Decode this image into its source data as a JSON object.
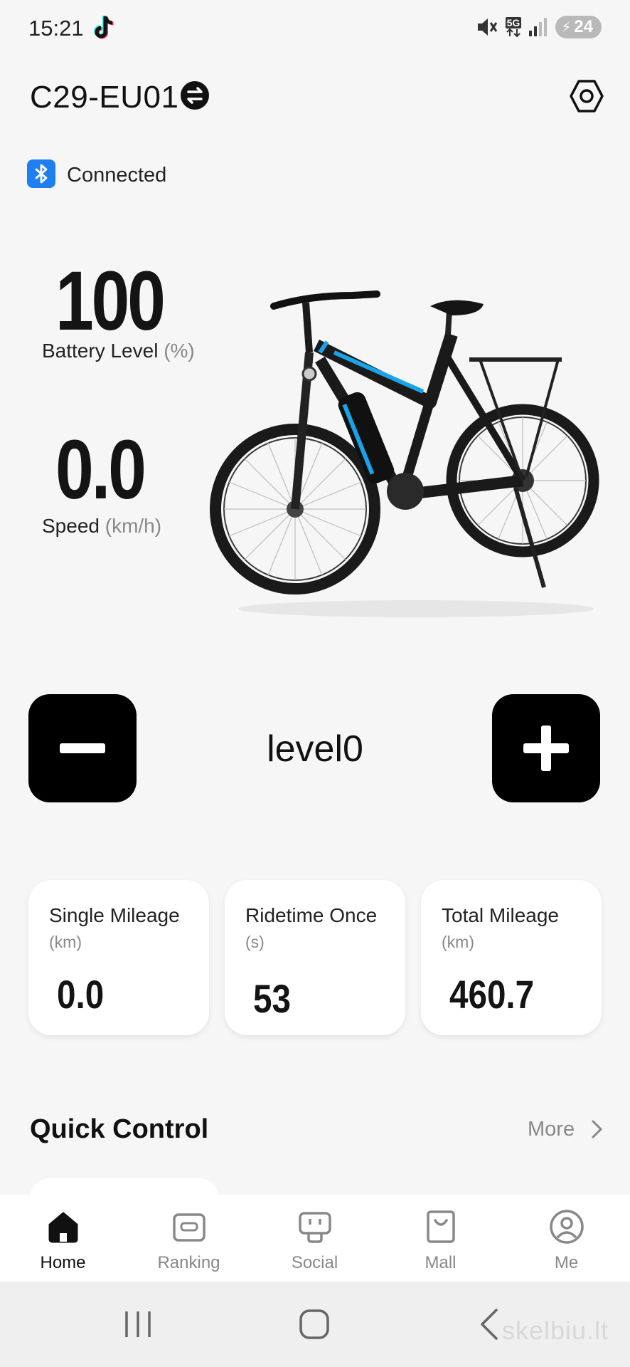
{
  "status_bar": {
    "time": "15:21",
    "network": "5G",
    "battery": "24"
  },
  "header": {
    "device_name": "C29-EU01",
    "connection_status": "Connected"
  },
  "metrics": {
    "battery_value": "100",
    "battery_label": "Battery Level",
    "battery_unit": "(%)",
    "speed_value": "0.0",
    "speed_label": "Speed",
    "speed_unit": "(km/h)"
  },
  "assist": {
    "level": "level0"
  },
  "stats": [
    {
      "title": "Single Mileage",
      "unit": "(km)",
      "value": "0.0"
    },
    {
      "title": "Ridetime Once",
      "unit": "(s)",
      "value": "53"
    },
    {
      "title": "Total Mileage",
      "unit": "(km)",
      "value": "460.7"
    }
  ],
  "quick_control": {
    "title": "Quick Control",
    "more_label": "More"
  },
  "bottom_nav": [
    {
      "label": "Home",
      "icon": "home-icon",
      "active": true
    },
    {
      "label": "Ranking",
      "icon": "ranking-icon",
      "active": false
    },
    {
      "label": "Social",
      "icon": "social-icon",
      "active": false
    },
    {
      "label": "Mall",
      "icon": "shopping-bag-icon",
      "active": false
    },
    {
      "label": "Me",
      "icon": "user-icon",
      "active": false
    }
  ],
  "watermark": "skelbiu.lt",
  "colors": {
    "bluetooth": "#1e7ef2",
    "bike_accent": "#1aa3e8"
  }
}
